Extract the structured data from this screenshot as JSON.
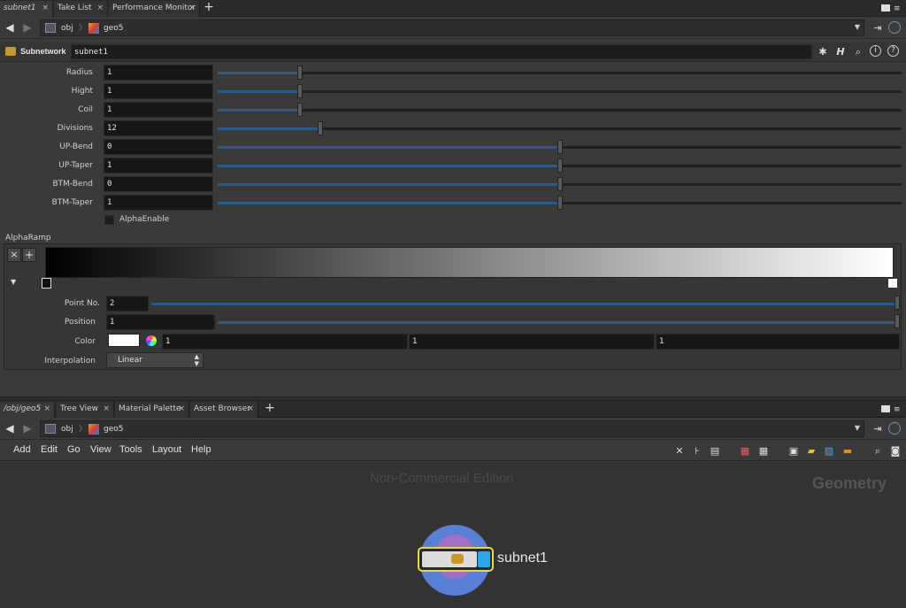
{
  "top_tabs": [
    {
      "label": "subnet1"
    },
    {
      "label": "Take List"
    },
    {
      "label": "Performance Monitor"
    }
  ],
  "close_glyph": "×",
  "plus_glyph": "+",
  "top_path": {
    "crumbs": [
      "obj",
      "geo5"
    ]
  },
  "node_header": {
    "type_label": "Subnetwork",
    "name_value": "subnet1"
  },
  "params": [
    {
      "label": "Radius",
      "value": "1"
    },
    {
      "label": "Hight",
      "value": "1"
    },
    {
      "label": "Coil",
      "value": "1"
    },
    {
      "label": "Divisions",
      "value": "12"
    },
    {
      "label": "UP-Bend",
      "value": "0"
    },
    {
      "label": "UP-Taper",
      "value": "1"
    },
    {
      "label": "BTM-Bend",
      "value": "0"
    },
    {
      "label": "BTM-Taper",
      "value": "1"
    }
  ],
  "slider_levels": [
    0.12,
    0.12,
    0.12,
    0.15,
    0.5,
    0.5,
    0.5,
    0.5
  ],
  "alpha_enable": {
    "label": "AlphaEnable",
    "checked": false
  },
  "alpha_ramp": {
    "title": "AlphaRamp",
    "remove_label": "×",
    "add_label": "+",
    "point_no_label": "Point No.",
    "point_no_value": "2",
    "position_label": "Position",
    "position_value": "1",
    "color_label": "Color",
    "color_values": [
      "1",
      "1",
      "1"
    ],
    "interpolation_label": "Interpolation",
    "interpolation_value": "Linear"
  },
  "bottom_tabs": [
    {
      "label": "/obj/geo5"
    },
    {
      "label": "Tree View"
    },
    {
      "label": "Material Palette"
    },
    {
      "label": "Asset Browser"
    }
  ],
  "bottom_path": {
    "crumbs": [
      "obj",
      "geo5"
    ]
  },
  "menu": [
    "Add",
    "Edit",
    "Go",
    "View",
    "Tools",
    "Layout",
    "Help"
  ],
  "network": {
    "watermark": "Non-Commercial Edition",
    "context_label": "Geometry",
    "node_name": "subnet1"
  },
  "colors": {
    "slider_fill": "#2d5a8c",
    "node_selected_border": "#e8d84a",
    "node_circle": "#5a7fd6",
    "node_purple": "#a070c8",
    "node_blue_flag": "#2aa6e8"
  }
}
